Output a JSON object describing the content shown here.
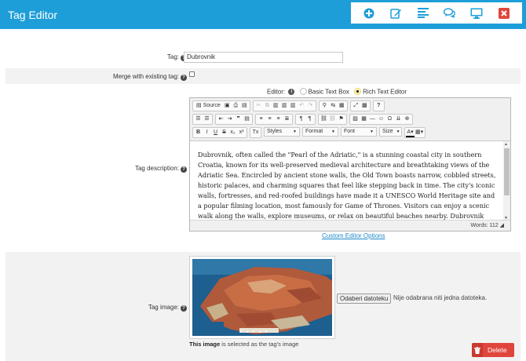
{
  "window": {
    "title": "Tag Editor"
  },
  "toolbox": [
    {
      "name": "add-icon",
      "color": "#1e9ed8"
    },
    {
      "name": "edit-icon",
      "color": "#1e9ed8"
    },
    {
      "name": "list-icon",
      "color": "#1e9ed8"
    },
    {
      "name": "comments-icon",
      "color": "#1e9ed8"
    },
    {
      "name": "monitor-icon",
      "color": "#1e9ed8"
    },
    {
      "name": "close-icon",
      "color": "#e0453c"
    }
  ],
  "form": {
    "tag_label": "Tag:",
    "tag_value": "Dubrovnik",
    "merge_label": "Merge with existing tag:",
    "merge_checked": false,
    "editor_label": "Editor:",
    "editor_option_basic": "Basic Text Box",
    "editor_option_rich": "Rich Text Editor",
    "editor_selected": "Rich Text Editor",
    "description_label": "Tag description:",
    "description_text": "Dubrovnik, often called the \"Pearl of the Adriatic,\" is a stunning coastal city in southern Croatia, known for its well-preserved medieval architecture and breathtaking views of the Adriatic Sea. Encircled by ancient stone walls, the Old Town boasts narrow, cobbled streets, historic palaces, and charming squares that feel like stepping back in time. The city's iconic walls, fortresses, and red-roofed buildings have made it a UNESCO World Heritage site and a popular filming location, most famously for Game of Thrones. Visitors can enjoy a scenic walk along the walls, explore museums, or relax on beautiful beaches nearby. Dubrovnik combines rich history with vibrant culture, offering a unique blend of past",
    "word_count": "Words: 112",
    "custom_editor_link": "Custom Editor Options",
    "image_label": "Tag image:",
    "file_button": "Odaberi datoteku",
    "file_status": "Nije odabrana niti jedna datoteka.",
    "image_note_bold": "This image",
    "image_note_rest": " is selected as the tag's image",
    "delete_label": "Delete"
  },
  "editor_toolbar": {
    "source": "Source",
    "combos": [
      "Styles",
      "Format",
      "Font",
      "Size"
    ]
  },
  "colors": {
    "accent": "#1e9ed8",
    "danger": "#e0453c",
    "link": "#1e88c8"
  }
}
